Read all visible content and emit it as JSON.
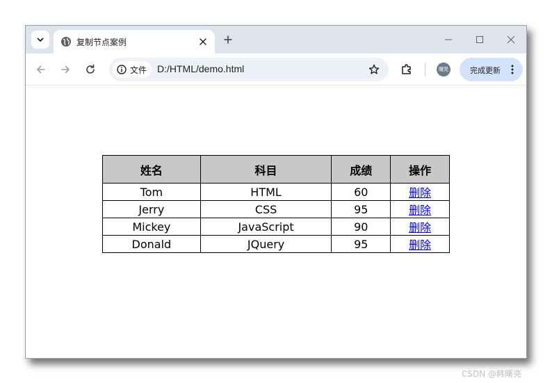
{
  "browser": {
    "tab": {
      "title": "复制节点案例",
      "favicon": "globe-icon"
    },
    "new_tab_symbol": "+",
    "address_bar": {
      "site_info_label": "文件",
      "url": "D:/HTML/demo.html"
    },
    "update_button_label": "完成更新",
    "profile_avatar_text": "曙亮"
  },
  "table": {
    "headers": [
      "姓名",
      "科目",
      "成绩",
      "操作"
    ],
    "rows": [
      {
        "name": "Tom",
        "subject": "HTML",
        "score": "60",
        "action": "删除"
      },
      {
        "name": "Jerry",
        "subject": "CSS",
        "score": "95",
        "action": "删除"
      },
      {
        "name": "Mickey",
        "subject": "JavaScript",
        "score": "90",
        "action": "删除"
      },
      {
        "name": "Donald",
        "subject": "JQuery",
        "score": "95",
        "action": "删除"
      }
    ]
  },
  "watermark": "CSDN @韩曙亮",
  "colors": {
    "titlebar": "#dfe3eb",
    "omnibox": "#edf0f7",
    "update_button": "#d3e3fd",
    "header_cell": "#c8c8c8",
    "link": "#0000ee"
  }
}
